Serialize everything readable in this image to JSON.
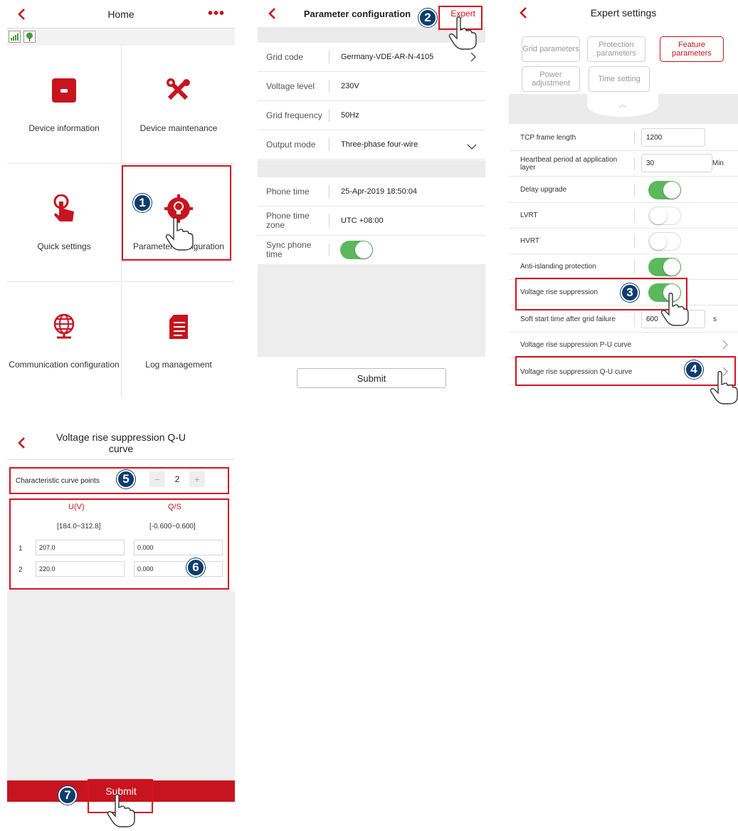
{
  "home": {
    "title": "Home",
    "menu_icon": "more-dots-icon",
    "tiles": [
      {
        "label": "Device information",
        "icon": "device-info-icon"
      },
      {
        "label": "Device maintenance",
        "icon": "tools-icon"
      },
      {
        "label": "Quick settings",
        "icon": "tap-icon"
      },
      {
        "label": "Parameter configuration",
        "icon": "bulb-gear-icon"
      },
      {
        "label": "Communication configuration",
        "icon": "globe-network-icon"
      },
      {
        "label": "Log management",
        "icon": "log-file-icon"
      }
    ]
  },
  "params": {
    "title": "Parameter configuration",
    "expert_label": "Expert",
    "rows": [
      {
        "key": "Grid code",
        "value": "Germany-VDE-AR-N-4105"
      },
      {
        "key": "Voltage level",
        "value": "230V"
      },
      {
        "key": "Grid frequency",
        "value": "50Hz"
      },
      {
        "key": "Output mode",
        "value": "Three-phase four-wire"
      },
      {
        "key": "Phone time",
        "value": "25-Apr-2019 18:50:04"
      },
      {
        "key": "Phone time zone",
        "value": "UTC +08:00"
      },
      {
        "key": "Sync phone time",
        "value": ""
      }
    ],
    "sync_phone_time_on": true,
    "submit_label": "Submit"
  },
  "expert": {
    "title": "Expert settings",
    "tabs": [
      {
        "label": "Grid parameters",
        "active": false
      },
      {
        "label": "Protection parameters",
        "active": false
      },
      {
        "label": "Feature parameters",
        "active": true
      },
      {
        "label": "Power adjustment",
        "active": false
      },
      {
        "label": "Time setting",
        "active": false
      }
    ],
    "rows": [
      {
        "key": "TCP frame length",
        "value": "1200",
        "unit": ""
      },
      {
        "key": "Heartbeat period at application layer",
        "value": "30",
        "unit": "Min"
      },
      {
        "key": "Delay upgrade",
        "toggle": true
      },
      {
        "key": "LVRT",
        "toggle": false
      },
      {
        "key": "HVRT",
        "toggle": false
      },
      {
        "key": "Anti-islanding protection",
        "toggle": true
      },
      {
        "key": "Voltage rise suppression",
        "toggle": true
      },
      {
        "key": "Soft start time after grid failure",
        "value": "600",
        "unit": "s"
      },
      {
        "key": "Voltage rise suppression P-U curve"
      },
      {
        "key": "Voltage rise suppression Q-U curve"
      }
    ]
  },
  "qu": {
    "title": "Voltage rise suppression Q-U curve",
    "points_label": "Characteristic curve points",
    "points_value": "2",
    "minus": "−",
    "plus": "+",
    "col_u": "U(V)",
    "col_q": "Q/S",
    "range_u": "[184.0~312.8]",
    "range_q": "[-0.600~0.600]",
    "rows": [
      {
        "idx": "1",
        "u": "207.0",
        "q": "0.000"
      },
      {
        "idx": "2",
        "u": "220.0",
        "q": "0.000"
      }
    ],
    "submit_label": "Submit"
  },
  "steps": [
    "1",
    "2",
    "3",
    "4",
    "5",
    "6",
    "7"
  ],
  "colors": {
    "brand_red": "#c8141e",
    "toggle_green": "#5cb85c",
    "badge_blue": "#0d3d6e"
  }
}
